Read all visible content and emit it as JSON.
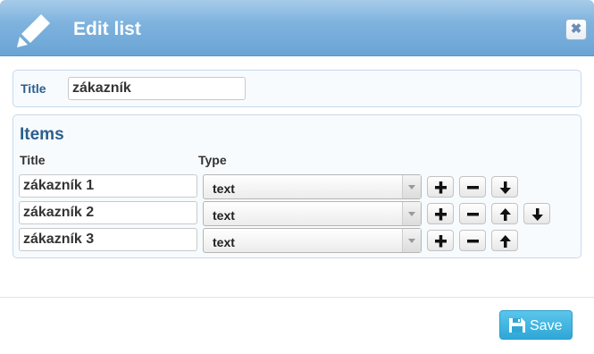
{
  "dialog": {
    "title": "Edit list",
    "close_label": "✖"
  },
  "title_section": {
    "label": "Title",
    "value": "zákazník"
  },
  "items_section": {
    "heading": "Items",
    "col_title": "Title",
    "col_type": "Type",
    "rows": [
      {
        "title": "zákazník 1",
        "type": "text"
      },
      {
        "title": "zákazník 2",
        "type": "text"
      },
      {
        "title": "zákazník 3",
        "type": "text"
      }
    ]
  },
  "footer": {
    "save_label": "Save"
  },
  "icons": {
    "header": "pencil-icon",
    "add": "plus-icon",
    "remove": "minus-icon",
    "up": "arrow-up-icon",
    "down": "arrow-down-icon",
    "save": "floppy-disk-icon",
    "close": "close-icon"
  },
  "colors": {
    "header_bg": "#7fb3de",
    "heading_text": "#2b5f8e",
    "save_bg": "#2fa7d6"
  }
}
